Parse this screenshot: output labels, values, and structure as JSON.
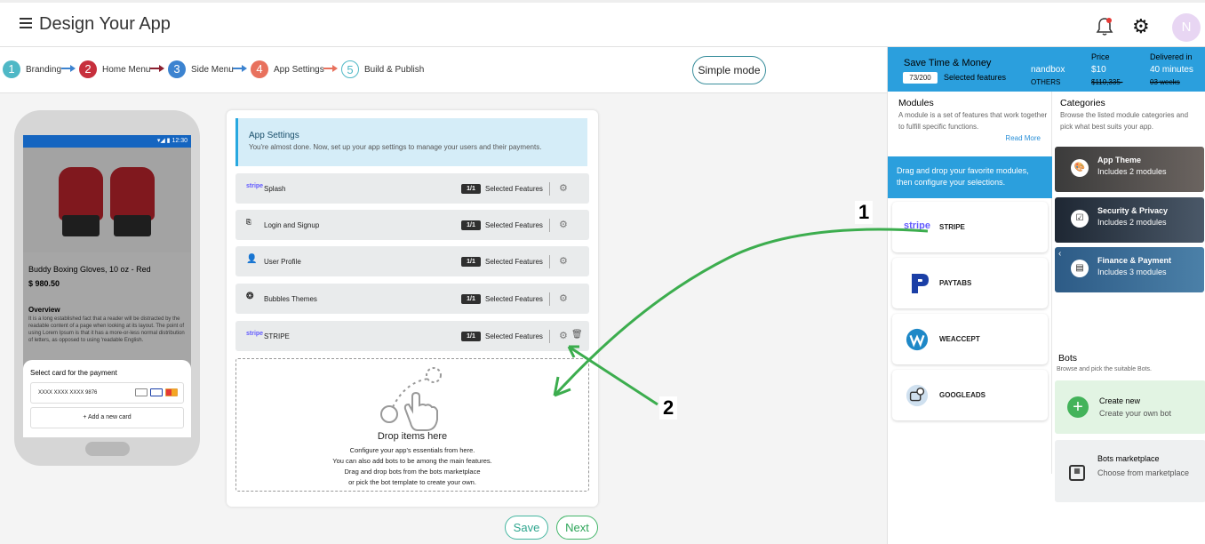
{
  "header": {
    "title": "Design Your App",
    "avatar_initial": "N"
  },
  "steps": [
    {
      "num": "1",
      "label": "Branding",
      "color": "#4fb8c6"
    },
    {
      "num": "2",
      "label": "Home Menu",
      "color": "#c7303d"
    },
    {
      "num": "3",
      "label": "Side Menu",
      "color": "#3c83d0"
    },
    {
      "num": "4",
      "label": "App Settings",
      "color": "#e8715d"
    },
    {
      "num": "5",
      "label": "Build & Publish",
      "color": "#ffffff"
    }
  ],
  "simple_mode": "Simple mode",
  "phone": {
    "status_time": "12:30",
    "product_name": "Buddy Boxing Gloves, 10 oz - Red",
    "price": "$ 980.50",
    "overview_title": "Overview",
    "overview_text": "It is a long established fact that a reader will be distracted by the readable content of a page when looking at its layout. The point of using Lorem Ipsum is that it has a more-or-less normal distribution of letters, as opposed to using 'readable English.",
    "payment_title": "Select card for the payment",
    "card_number": "XXXX XXXX XXXX 9876",
    "add_card": "+ Add a new card"
  },
  "settings": {
    "title": "App Settings",
    "subtitle": "You're almost done. Now, set up your app settings to manage your users and their payments.",
    "features": [
      {
        "name": "Splash",
        "icon": "stripe",
        "count": "1/1",
        "selected": "Selected Features"
      },
      {
        "name": "Login and Signup",
        "icon": "login-icon",
        "count": "1/1",
        "selected": "Selected Features"
      },
      {
        "name": "User Profile",
        "icon": "user-icon",
        "count": "1/1",
        "selected": "Selected Features"
      },
      {
        "name": "Bubbles Themes",
        "icon": "bubbles-icon",
        "count": "1/1",
        "selected": "Selected Features"
      },
      {
        "name": "STRIPE",
        "icon": "stripe",
        "count": "1/1",
        "selected": "Selected Features"
      }
    ],
    "drop_title": "Drop items here",
    "drop_lines": [
      "Configure your app's essentials from here.",
      "You can also add bots to be among the main features.",
      "Drag and drop bots from the bots marketplace",
      "or pick the bot template to create your own."
    ]
  },
  "buttons": {
    "save": "Save",
    "next": "Next"
  },
  "promo": {
    "title": "Save Time & Money",
    "badge": "73/200",
    "badge_label": "Selected features",
    "sandbox": "nandbox",
    "others": "OTHERS",
    "price_head": "Price",
    "price": "$10",
    "price_old": "$110,335-",
    "delivery_head": "Delivered in",
    "delivery": "40 minutes",
    "delivery_old": "03 weeks"
  },
  "modules": {
    "title": "Modules",
    "desc": "A module is a set of features that work together to fulfill specific functions.",
    "read_more": "Read More",
    "drag_tip": "Drag and drop your favorite modules, then configure your selections.",
    "items": [
      {
        "name": "STRIPE",
        "logo": "stripe"
      },
      {
        "name": "PAYTABS",
        "logo": "P"
      },
      {
        "name": "WEACCEPT",
        "logo": "W"
      },
      {
        "name": "GOOGLEADS",
        "logo": "G"
      }
    ]
  },
  "categories": {
    "title": "Categories",
    "desc": "Browse the listed module categories and pick what best suits your app.",
    "items": [
      {
        "name": "App Theme",
        "sub": "Includes 2 modules"
      },
      {
        "name": "Security & Privacy",
        "sub": "Includes 2 modules"
      },
      {
        "name": "Finance & Payment",
        "sub": "Includes 3 modules"
      }
    ]
  },
  "bots": {
    "title": "Bots",
    "desc": "Browse and pick the suitable Bots.",
    "create_title": "Create new",
    "create_sub": "Create your own bot",
    "market_title": "Bots marketplace",
    "market_sub": "Choose from marketplace"
  },
  "annotations": {
    "one": "1",
    "two": "2"
  }
}
